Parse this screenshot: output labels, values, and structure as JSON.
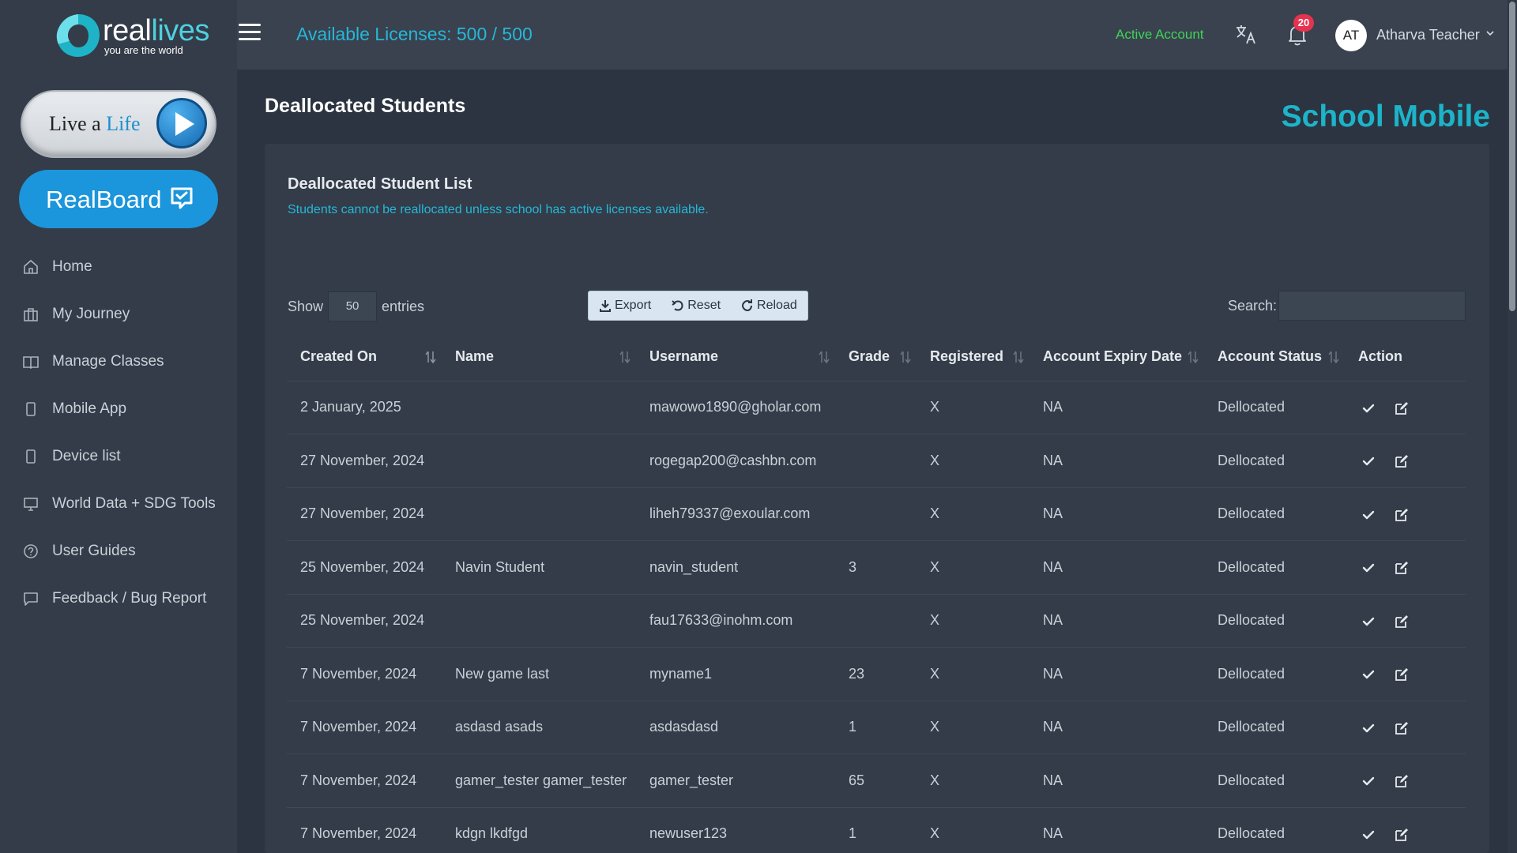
{
  "brand": {
    "logo_word_prefix": "real",
    "logo_word_suffix": "lives",
    "logo_tagline": "you are the world",
    "live_a": "Live a",
    "life": "Life",
    "realboard_label": "RealBoard"
  },
  "sidebar": {
    "items": [
      {
        "label": "Home",
        "icon": "home-icon"
      },
      {
        "label": "My Journey",
        "icon": "briefcase-icon"
      },
      {
        "label": "Manage Classes",
        "icon": "book-icon"
      },
      {
        "label": "Mobile App",
        "icon": "mobile-icon"
      },
      {
        "label": "Device list",
        "icon": "device-icon"
      },
      {
        "label": "World Data + SDG Tools",
        "icon": "monitor-icon"
      },
      {
        "label": "User Guides",
        "icon": "help-circle-icon"
      },
      {
        "label": "Feedback / Bug Report",
        "icon": "message-icon"
      }
    ]
  },
  "topbar": {
    "licenses": "Available Licenses: 500 / 500",
    "active_account": "Active Account",
    "notification_count": "20",
    "avatar_initials": "AT",
    "user_name": "Atharva Teacher"
  },
  "page": {
    "title": "Deallocated Students",
    "school_mobile": "School Mobile"
  },
  "card": {
    "title": "Deallocated Student List",
    "note": "Students cannot be reallocated unless school has active licenses available."
  },
  "table_controls": {
    "show": "Show",
    "entries_value": "50",
    "entries": "entries",
    "export": "Export",
    "reset": "Reset",
    "reload": "Reload",
    "search_label": "Search:",
    "search_value": ""
  },
  "table": {
    "headers": [
      "Created On",
      "Name",
      "Username",
      "Grade",
      "Registered",
      "Account Expiry Date",
      "Account Status",
      "Action"
    ],
    "rows": [
      {
        "created": "2 January, 2025",
        "name": "",
        "username": "mawowo1890@gholar.com",
        "grade": "",
        "registered": "X",
        "expiry": "NA",
        "status": "Dellocated"
      },
      {
        "created": "27 November, 2024",
        "name": "",
        "username": "rogegap200@cashbn.com",
        "grade": "",
        "registered": "X",
        "expiry": "NA",
        "status": "Dellocated"
      },
      {
        "created": "27 November, 2024",
        "name": "",
        "username": "liheh79337@exoular.com",
        "grade": "",
        "registered": "X",
        "expiry": "NA",
        "status": "Dellocated"
      },
      {
        "created": "25 November, 2024",
        "name": "Navin Student",
        "username": "navin_student",
        "grade": "3",
        "registered": "X",
        "expiry": "NA",
        "status": "Dellocated"
      },
      {
        "created": "25 November, 2024",
        "name": "",
        "username": "fau17633@inohm.com",
        "grade": "",
        "registered": "X",
        "expiry": "NA",
        "status": "Dellocated"
      },
      {
        "created": "7 November, 2024",
        "name": "New game last",
        "username": "myname1",
        "grade": "23",
        "registered": "X",
        "expiry": "NA",
        "status": "Dellocated"
      },
      {
        "created": "7 November, 2024",
        "name": "asdasd asads",
        "username": "asdasdasd",
        "grade": "1",
        "registered": "X",
        "expiry": "NA",
        "status": "Dellocated"
      },
      {
        "created": "7 November, 2024",
        "name": "gamer_tester gamer_tester",
        "username": "gamer_tester",
        "grade": "65",
        "registered": "X",
        "expiry": "NA",
        "status": "Dellocated"
      },
      {
        "created": "7 November, 2024",
        "name": "kdgn lkdfgd",
        "username": "newuser123",
        "grade": "1",
        "registered": "X",
        "expiry": "NA",
        "status": "Dellocated"
      }
    ]
  },
  "colors": {
    "accent_cyan": "#26b7d9",
    "active_green": "#3fd35a",
    "badge_red": "#e5334f",
    "realboard_blue": "#1b95db"
  }
}
